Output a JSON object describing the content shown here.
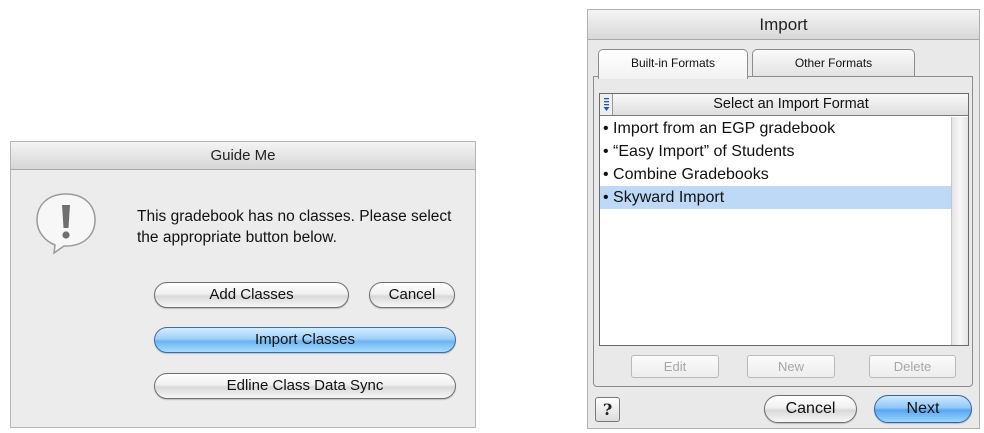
{
  "guide_dialog": {
    "title": "Guide Me",
    "message": "This gradebook has no classes. Please select the appropriate button below.",
    "buttons": {
      "add_classes": "Add Classes",
      "cancel": "Cancel",
      "import_classes": "Import Classes",
      "edline_sync": "Edline Class Data Sync"
    },
    "icon": "alert-icon"
  },
  "import_dialog": {
    "title": "Import",
    "tabs": [
      {
        "label": "Built-in Formats",
        "active": true
      },
      {
        "label": "Other Formats",
        "active": false
      }
    ],
    "list": {
      "header": "Select an Import Format",
      "items": [
        {
          "label": "• Import from an EGP gradebook",
          "selected": false
        },
        {
          "label": "• “Easy Import” of Students",
          "selected": false
        },
        {
          "label": "• Combine Gradebooks",
          "selected": false
        },
        {
          "label": "• Skyward Import",
          "selected": true
        }
      ]
    },
    "list_buttons": {
      "edit": "Edit",
      "new": "New",
      "delete": "Delete"
    },
    "help": "?",
    "footer": {
      "cancel": "Cancel",
      "next": "Next"
    }
  },
  "colors": {
    "selection": "#bdd9f6",
    "default_button": "#6cb4f2",
    "dialog_bg": "#ececec"
  }
}
